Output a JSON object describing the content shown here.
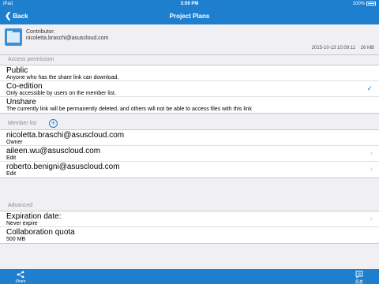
{
  "statusbar": {
    "device": "iPad",
    "time": "3:09 PM",
    "battery": "100%"
  },
  "navbar": {
    "back_label": "Back",
    "title": "Project Plans"
  },
  "file": {
    "contributor_label": "Contributor:",
    "contributor_email": "nicoletta.braschi@asuscloud.com",
    "modified": "2015-10-13 10:09:11",
    "size": "26 MB"
  },
  "access": {
    "header": "Access permission",
    "options": [
      {
        "title": "Public",
        "desc": "Anyone who has the share link can download.",
        "selected": false
      },
      {
        "title": "Co-edition",
        "desc": "Only accessible by users on the member list.",
        "selected": true
      },
      {
        "title": "Unshare",
        "desc": "The currently link will be permanently deleted, and others will not be able to access files with this link",
        "selected": false
      }
    ]
  },
  "members": {
    "header": "Member list",
    "items": [
      {
        "email": "nicoletta.braschi@asuscloud.com",
        "role": "Owner"
      },
      {
        "email": "aileen.wu@asuscloud.com",
        "role": "Edit"
      },
      {
        "email": "roberto.benigni@asuscloud.com",
        "role": "Edit"
      }
    ]
  },
  "advanced": {
    "header": "Advanced",
    "items": [
      {
        "title": "Expiration date:",
        "value": "Never expire"
      },
      {
        "title": "Collaboration quota",
        "value": "500 MB"
      }
    ]
  },
  "toolbar": {
    "share_label": "Share",
    "comment_label": "訊息"
  },
  "colors": {
    "accent": "#1f7fcf",
    "background": "#efeff4"
  }
}
